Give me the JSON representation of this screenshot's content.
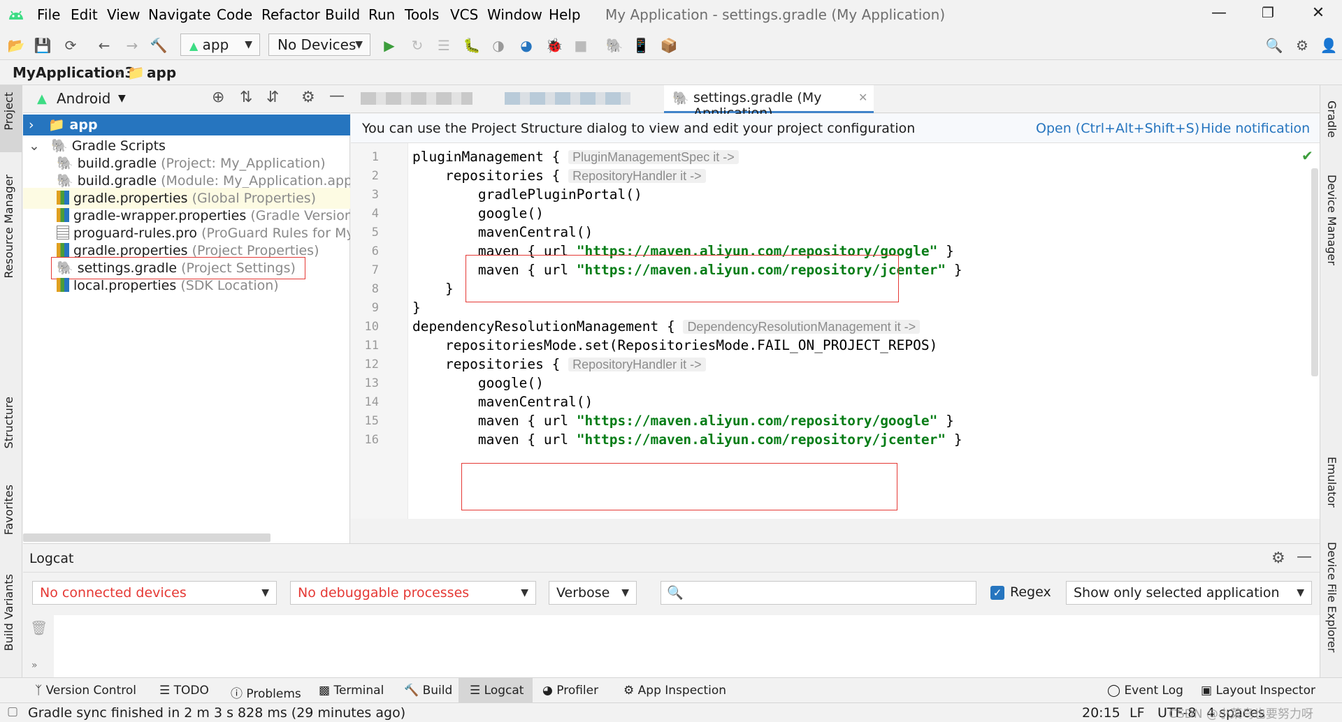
{
  "menu": [
    "File",
    "Edit",
    "View",
    "Navigate",
    "Code",
    "Refactor",
    "Build",
    "Run",
    "Tools",
    "VCS",
    "Window",
    "Help"
  ],
  "window_title": "My Application - settings.gradle (My Application)",
  "toolbar": {
    "run_config": "app",
    "device": "No Devices"
  },
  "breadcrumb": {
    "project": "MyApplication3",
    "module": "app"
  },
  "left_strip": {
    "project": "Project",
    "resource_manager": "Resource Manager",
    "structure": "Structure",
    "favorites": "Favorites",
    "build_variants": "Build Variants"
  },
  "right_strip": {
    "gradle": "Gradle",
    "device_manager": "Device Manager",
    "emulator": "Emulator",
    "device_file_explorer": "Device File Explorer"
  },
  "project_panel": {
    "view_mode": "Android",
    "tree": [
      {
        "name": "app",
        "note": ""
      },
      {
        "name": "Gradle Scripts",
        "note": ""
      },
      {
        "name": "build.gradle",
        "note": "(Project: My_Application)"
      },
      {
        "name": "build.gradle",
        "note": "(Module: My_Application.app)"
      },
      {
        "name": "gradle.properties",
        "note": "(Global Properties)"
      },
      {
        "name": "gradle-wrapper.properties",
        "note": "(Gradle Version)"
      },
      {
        "name": "proguard-rules.pro",
        "note": "(ProGuard Rules for My_"
      },
      {
        "name": "gradle.properties",
        "note": "(Project Properties)"
      },
      {
        "name": "settings.gradle",
        "note": "(Project Settings)"
      },
      {
        "name": "local.properties",
        "note": "(SDK Location)"
      }
    ]
  },
  "editor": {
    "active_tab": "settings.gradle (My Application)",
    "notification": "You can use the Project Structure dialog to view and edit your project configuration",
    "notification_open": "Open (Ctrl+Alt+Shift+S)",
    "notification_hide": "Hide notification",
    "lines": [
      {
        "n": "1",
        "t": "pluginManagement {",
        "hint": "PluginManagementSpec it ->"
      },
      {
        "n": "2",
        "t": "    repositories {",
        "hint": "RepositoryHandler it ->"
      },
      {
        "n": "3",
        "t": "        gradlePluginPortal()",
        "hint": ""
      },
      {
        "n": "4",
        "t": "        google()",
        "hint": ""
      },
      {
        "n": "5",
        "t": "        mavenCentral()",
        "hint": ""
      },
      {
        "n": "6",
        "pre": "        maven { url ",
        "str": "\"https://maven.aliyun.com/repository/google\"",
        "post": " }"
      },
      {
        "n": "7",
        "pre": "        maven { url ",
        "str": "\"https://maven.aliyun.com/repository/jcenter\"",
        "post": " }"
      },
      {
        "n": "8",
        "t": "    }",
        "hint": ""
      },
      {
        "n": "9",
        "t": "}",
        "hint": ""
      },
      {
        "n": "10",
        "t": "dependencyResolutionManagement {",
        "hint": "DependencyResolutionManagement it ->"
      },
      {
        "n": "11",
        "t": "    repositoriesMode.set(RepositoriesMode.FAIL_ON_PROJECT_REPOS)",
        "hint": ""
      },
      {
        "n": "12",
        "t": "    repositories {",
        "hint": "RepositoryHandler it ->"
      },
      {
        "n": "13",
        "t": "        google()",
        "hint": ""
      },
      {
        "n": "14",
        "t": "        mavenCentral()",
        "hint": ""
      },
      {
        "n": "15",
        "pre": "        maven { url ",
        "str": "\"https://maven.aliyun.com/repository/google\"",
        "post": " }"
      },
      {
        "n": "16",
        "pre": "        maven { url ",
        "str": "\"https://maven.aliyun.com/repository/jcenter\"",
        "post": " }"
      }
    ]
  },
  "logcat": {
    "title": "Logcat",
    "device": "No connected devices",
    "process": "No debuggable processes",
    "level": "Verbose",
    "search_value": "",
    "regex_label": "Regex",
    "regex_checked": true,
    "filter": "Show only selected application"
  },
  "bottom_tabs": [
    "Version Control",
    "TODO",
    "Problems",
    "Terminal",
    "Build",
    "Logcat",
    "Profiler",
    "App Inspection"
  ],
  "bottom_right_tabs": [
    "Event Log",
    "Layout Inspector"
  ],
  "status": {
    "message": "Gradle sync finished in 2 m 3 s 828 ms (29 minutes ago)",
    "position": "20:15",
    "line_sep": "LF",
    "encoding": "UTF-8",
    "indent": "4 spaces"
  },
  "watermark": "CSDN @小菜鸟也要努力呀",
  "colors": {
    "accent": "#2675bf",
    "selection": "#2675bf",
    "string": "#067d17",
    "highlight_box": "#e53935",
    "android_green": "#3ddc84"
  }
}
